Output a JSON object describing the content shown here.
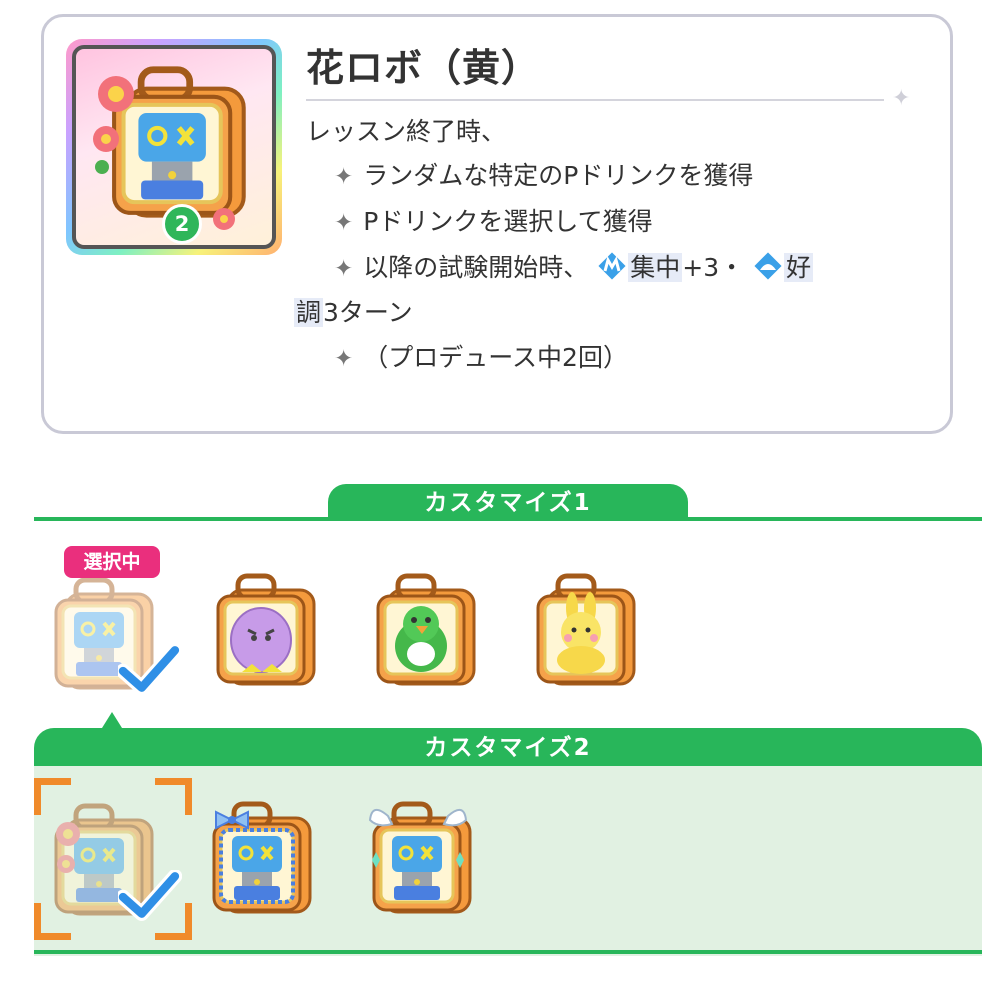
{
  "item": {
    "title": "花ロボ（黄）",
    "level_badge": "2",
    "description": {
      "intro": "レッスン終了時、",
      "bullet_symbol": "✦",
      "bullet1": "ランダムな特定のPドリンクを獲得",
      "bullet2": "Pドリンクを選択して獲得",
      "bullet3_prefix": "以降の試験開始時、",
      "effect1_label": "集中",
      "effect1_value": "+3・",
      "effect2_label": "好",
      "effect2_label_cont": "調",
      "continuation_suffix": "3ターン",
      "bullet4": "（プロデュース中2回）"
    }
  },
  "customize1": {
    "title": "カスタマイズ1",
    "selected_label": "選択中",
    "options": [
      {
        "name": "robot-bag",
        "selected": true
      },
      {
        "name": "purple-fluffy-bag",
        "selected": false
      },
      {
        "name": "green-bird-bag",
        "selected": false
      },
      {
        "name": "yellow-bunny-bag",
        "selected": false
      }
    ]
  },
  "customize2": {
    "title": "カスタマイズ2",
    "options": [
      {
        "name": "flower-robot-bag",
        "selected": true
      },
      {
        "name": "ribbon-robot-bag",
        "selected": false
      },
      {
        "name": "wing-robot-bag",
        "selected": false
      }
    ]
  },
  "colors": {
    "accent_green": "#28b65a",
    "selected_badge_pink": "#ea2f7d",
    "selection_frame_orange": "#f08a2a",
    "checkmark_blue": "#2f8fe6"
  }
}
